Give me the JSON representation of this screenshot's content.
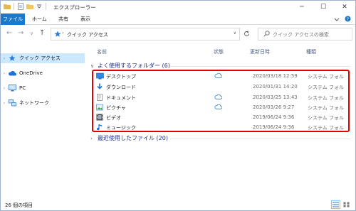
{
  "window": {
    "title": "エクスプローラー"
  },
  "ribbon": {
    "tabs": [
      "ファイル",
      "ホーム",
      "共有",
      "表示"
    ]
  },
  "address": {
    "path": "クイック アクセス",
    "search_placeholder": "クイック アクセスの検索"
  },
  "sidebar": {
    "items": [
      {
        "label": "クイック アクセス",
        "icon": "star-icon"
      },
      {
        "label": "OneDrive",
        "icon": "cloud-icon"
      },
      {
        "label": "PC",
        "icon": "pc-icon"
      },
      {
        "label": "ネットワーク",
        "icon": "network-icon"
      }
    ]
  },
  "columns": {
    "name": "名前",
    "status": "状態",
    "date": "更新日時",
    "type": "種類"
  },
  "groups": {
    "frequent": {
      "label": "よく使用するフォルダー (6)"
    },
    "recent": {
      "label": "最近使用したファイル (20)"
    }
  },
  "folders": [
    {
      "name": "デスクトップ",
      "cloud": true,
      "date": "2020/03/18 12:59",
      "type": "システム フォル",
      "icon": "desktop-icon"
    },
    {
      "name": "ダウンロード",
      "cloud": false,
      "date": "2020/01/31 14:20",
      "type": "システム フォル",
      "icon": "download-icon"
    },
    {
      "name": "ドキュメント",
      "cloud": true,
      "date": "2020/03/25 13:43",
      "type": "システム フォル",
      "icon": "document-icon"
    },
    {
      "name": "ピクチャ",
      "cloud": true,
      "date": "2020/03/26 9:27",
      "type": "システム フォル",
      "icon": "picture-icon"
    },
    {
      "name": "ビデオ",
      "cloud": false,
      "date": "2019/06/24 9:36",
      "type": "システム フォル",
      "icon": "video-icon"
    },
    {
      "name": "ミュージック",
      "cloud": false,
      "date": "2019/06/24 9:36",
      "type": "システム フォル",
      "icon": "music-icon"
    }
  ],
  "status": {
    "count": "26 個の項目"
  },
  "colors": {
    "accent": "#1979ca",
    "selection": "#cce8ff",
    "highlight": "#e00000",
    "group": "#1e3287"
  }
}
